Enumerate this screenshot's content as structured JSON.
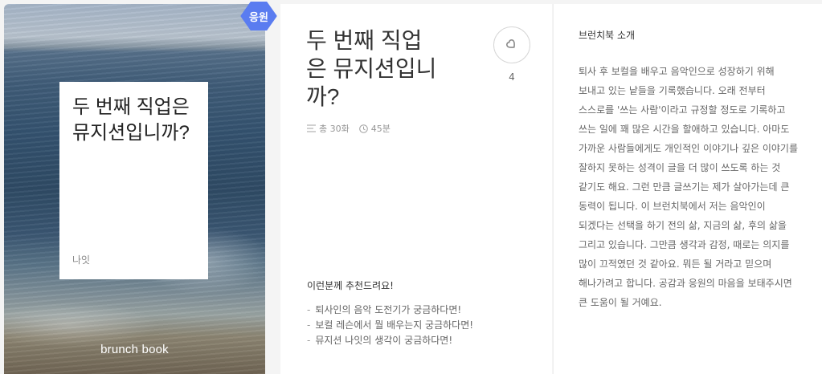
{
  "cover": {
    "title": "두 번째 직업은 뮤지션입니까?",
    "author": "나잇",
    "logo": "brunch book"
  },
  "support_badge": {
    "label": "응원",
    "color": "#5a7cf0"
  },
  "info": {
    "title": "두 번째 직업은 뮤지션입니까?",
    "episodes": "총 30화",
    "duration": "45분",
    "episodes_icon": "list-icon",
    "duration_icon": "clock-icon",
    "like_icon": "like-icon",
    "like_count": "4",
    "recommend_title": "이런분께 추천드려요!",
    "recommend_items": [
      "퇴사인의 음악 도전기가 궁금하다면!",
      "보컬 레슨에서 뭘 배우는지 궁금하다면!",
      "뮤지션 나잇의 생각이 궁금하다면!"
    ]
  },
  "description": {
    "heading": "브런치북 소개",
    "body": "퇴사 후 보컬을 배우고 음악인으로 성장하기 위해 보내고 있는 낱들을 기록했습니다. 오래 전부터 스스로를 '쓰는 사람'이라고 규정할 정도로 기록하고 쓰는 일에 꽤 많은 시간을 할애하고 있습니다. 아마도 가까운 사람들에게도 개인적인 이야기나 깊은 이야기를 잘하지 못하는 성격이 글을 더 많이 쓰도록 하는 것 같기도 해요. 그런 만큼 글쓰기는 제가 살아가는데 큰 동력이 됩니다. 이 브런치북에서 저는 음악인이 되겠다는 선택을 하기 전의 삶, 지금의 삶, 후의 삶을 그리고 있습니다. 그만큼 생각과 감정, 때로는 의지를 많이 끄적였던 것 같아요. 뭐든 될 거라고 믿으며 해나가려고 합니다. 공감과 응원의 마음을 보태주시면 큰 도움이 될 거예요."
  }
}
